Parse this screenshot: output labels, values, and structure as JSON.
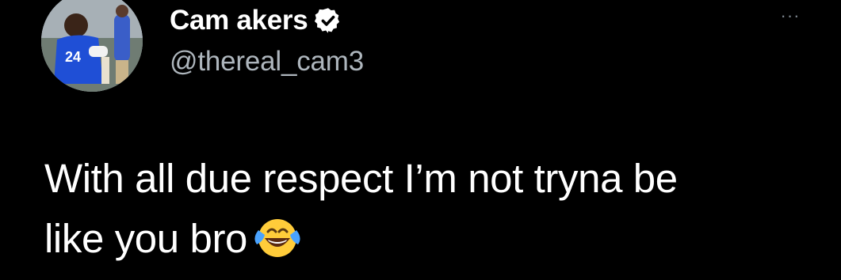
{
  "author": {
    "display_name": "Cam akers",
    "handle": "@thereal_cam3",
    "verified": true,
    "avatar": "profile-photo"
  },
  "menu": {
    "more_label": "···"
  },
  "tweet": {
    "text_line_1": "With all due respect I’m not tryna be",
    "text_line_2": "like you bro",
    "emoji": "face-with-tears-of-joy"
  },
  "colors": {
    "background": "#000000",
    "text": "#ffffff",
    "secondary_text": "#aeb6bd",
    "verified_badge": "#ffffff"
  }
}
